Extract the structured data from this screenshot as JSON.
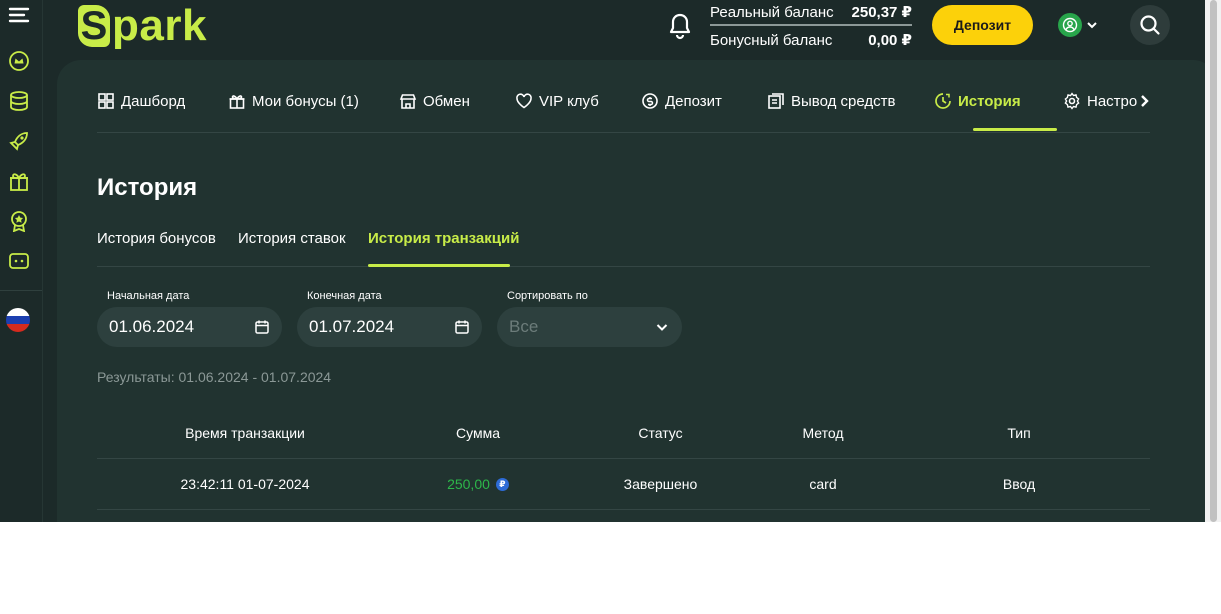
{
  "header": {
    "logo_initial": "S",
    "logo_rest": "park",
    "real_balance_label": "Реальный баланс",
    "real_balance_value": "250,37 ₽",
    "bonus_balance_label": "Бонусный баланс",
    "bonus_balance_value": "0,00 ₽",
    "deposit_label": "Депозит"
  },
  "sidebar": {
    "icons": [
      "menu-icon",
      "crown-icon",
      "coins-icon",
      "rocket-icon",
      "gift-icon",
      "medal-icon",
      "ticket-icon"
    ],
    "flag": "russia-flag"
  },
  "nav": {
    "items": [
      {
        "label": "Дашборд",
        "icon": "dashboard-icon"
      },
      {
        "label": "Мои бонусы (1)",
        "icon": "gift-icon"
      },
      {
        "label": "Обмен",
        "icon": "shop-icon"
      },
      {
        "label": "VIP клуб",
        "icon": "heart-icon"
      },
      {
        "label": "Депозит",
        "icon": "coin-icon"
      },
      {
        "label": "Вывод средств",
        "icon": "withdraw-icon"
      },
      {
        "label": "История",
        "icon": "history-icon",
        "active": true
      },
      {
        "label": "Настро",
        "icon": "settings-icon"
      }
    ]
  },
  "page": {
    "title": "История",
    "subtabs": [
      "История бонусов",
      "История ставок",
      "История транзакций"
    ],
    "active_subtab": "История транзакций"
  },
  "filters": {
    "start_label": "Начальная дата",
    "start_value": "01.06.2024",
    "end_label": "Конечная дата",
    "end_value": "01.07.2024",
    "sort_label": "Сортировать по",
    "sort_value": "Все"
  },
  "results_text": "Результаты: 01.06.2024 - 01.07.2024",
  "table": {
    "columns": [
      "Время транзакции",
      "Сумма",
      "Статус",
      "Метод",
      "Тип"
    ],
    "rows": [
      {
        "time": "23:42:11 01-07-2024",
        "amount": "250,00",
        "currency": "₽",
        "status": "Завершено",
        "method": "card",
        "type": "Ввод"
      }
    ]
  },
  "colors": {
    "background": "#1c2a29",
    "panel": "#213330",
    "accent": "#c8ec48",
    "deposit_button": "#fcd10a",
    "amount_positive": "#2db64a"
  }
}
